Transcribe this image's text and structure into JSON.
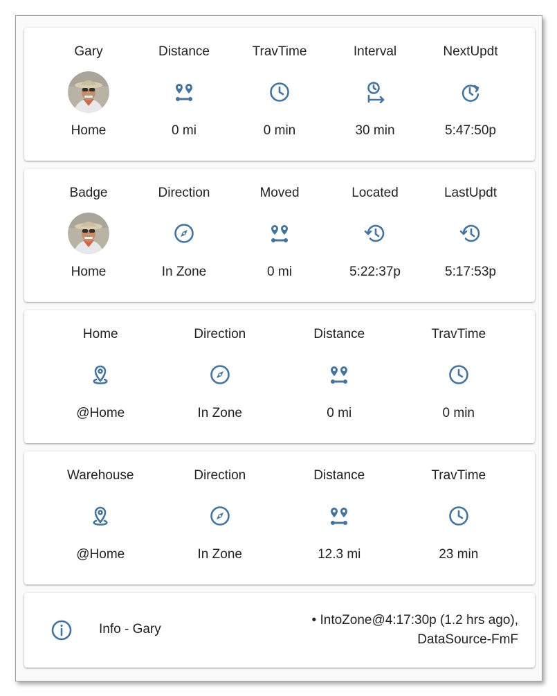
{
  "colors": {
    "icon": "#44739e",
    "text": "#212121",
    "card": "#ffffff"
  },
  "cards": [
    {
      "columns": [
        {
          "label": "Gary",
          "icon": "avatar-photo",
          "value": "Home"
        },
        {
          "label": "Distance",
          "icon": "map-marker-distance-icon",
          "value": "0 mi"
        },
        {
          "label": "TravTime",
          "icon": "clock-icon",
          "value": "0 min"
        },
        {
          "label": "Interval",
          "icon": "timer-arrow-icon",
          "value": "30 min"
        },
        {
          "label": "NextUpdt",
          "icon": "clock-forward-icon",
          "value": "5:47:50p"
        }
      ]
    },
    {
      "columns": [
        {
          "label": "Badge",
          "icon": "avatar-photo",
          "value": "Home"
        },
        {
          "label": "Direction",
          "icon": "compass-icon",
          "value": "In Zone"
        },
        {
          "label": "Moved",
          "icon": "map-marker-distance-icon",
          "value": "0 mi"
        },
        {
          "label": "Located",
          "icon": "history-icon",
          "value": "5:22:37p"
        },
        {
          "label": "LastUpdt",
          "icon": "history-icon",
          "value": "5:17:53p"
        }
      ]
    },
    {
      "columns": [
        {
          "label": "Home",
          "icon": "map-marker-icon",
          "value": "@Home"
        },
        {
          "label": "Direction",
          "icon": "compass-icon",
          "value": "In Zone"
        },
        {
          "label": "Distance",
          "icon": "map-marker-distance-icon",
          "value": "0 mi"
        },
        {
          "label": "TravTime",
          "icon": "clock-icon",
          "value": "0 min"
        }
      ]
    },
    {
      "columns": [
        {
          "label": "Warehouse",
          "icon": "map-marker-icon",
          "value": "@Home"
        },
        {
          "label": "Direction",
          "icon": "compass-icon",
          "value": "In Zone"
        },
        {
          "label": "Distance",
          "icon": "map-marker-distance-icon",
          "value": "12.3 mi"
        },
        {
          "label": "TravTime",
          "icon": "clock-icon",
          "value": "23 min"
        }
      ]
    }
  ],
  "info": {
    "icon": "information-icon",
    "title": "Info - Gary",
    "line1": "• IntoZone@4:17:30p (1.2 hrs ago),",
    "line2": "DataSource-FmF"
  }
}
